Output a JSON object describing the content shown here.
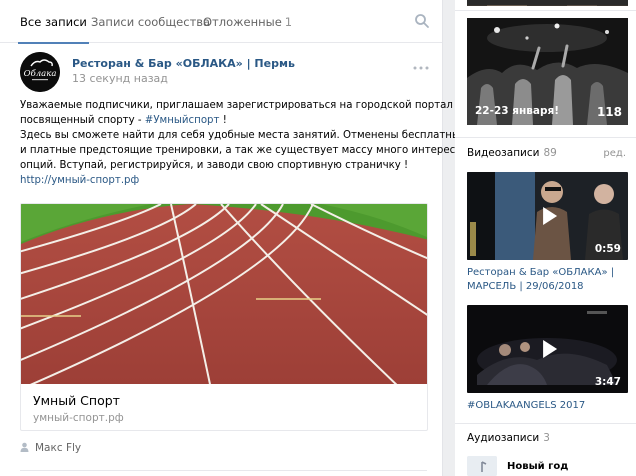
{
  "tabs": [
    {
      "label": "Все записи",
      "count": ""
    },
    {
      "label": "Записи сообщества",
      "count": ""
    },
    {
      "label": "Отложенные",
      "count": "1"
    }
  ],
  "post": {
    "author": "Ресторан & Бар «ОБЛАКА» | Пермь",
    "time": "13 секунд назад",
    "avatar_text": "Облака",
    "text_lines": [
      {
        "before": "Уважаемые подписчики, приглашаем зарегистрироваться на городской портал",
        "link": "",
        "after": ""
      },
      {
        "before": "посвященный спорту - ",
        "link": "#Умныйспорт",
        "after": " !"
      },
      {
        "before": "Здесь вы сможете найти для себя удобные места занятий. Отменены бесплатные",
        "link": "",
        "after": ""
      },
      {
        "before": "и платные предстоящие тренировки, а так же существует массу много интересных",
        "link": "",
        "after": ""
      },
      {
        "before": "опций. Вступай, регистрируйся, и заводи свою спортивную страничку !",
        "link": "",
        "after": ""
      },
      {
        "before": "",
        "link": "http://умный-спорт.рф",
        "after": ""
      }
    ],
    "snippet": {
      "title": "Умный Спорт",
      "domain": "умный-спорт.рф"
    },
    "signer": "Макс Fly"
  },
  "sidebar": {
    "photo_album": {
      "caption": "22-23 января!",
      "count": "118"
    },
    "videos": {
      "label": "Видеозаписи",
      "count": "89",
      "action": "ред.",
      "items": [
        {
          "duration": "0:59",
          "title_line1": "Ресторан & Бар «ОБЛАКА» |",
          "title_line2": "МАРСЕЛЬ | 29/06/2018"
        },
        {
          "duration": "3:47",
          "title_line1": "#OBLAKAANGELS 2017",
          "title_line2": ""
        }
      ]
    },
    "audio": {
      "label": "Аудиозаписи",
      "count": "3",
      "items": [
        {
          "title": "Новый год"
        }
      ]
    }
  },
  "colors": {
    "link": "#2a5885",
    "accent": "#5181b8",
    "muted": "#939393",
    "track": "#a8473e",
    "grass": "#4d9a2e"
  }
}
